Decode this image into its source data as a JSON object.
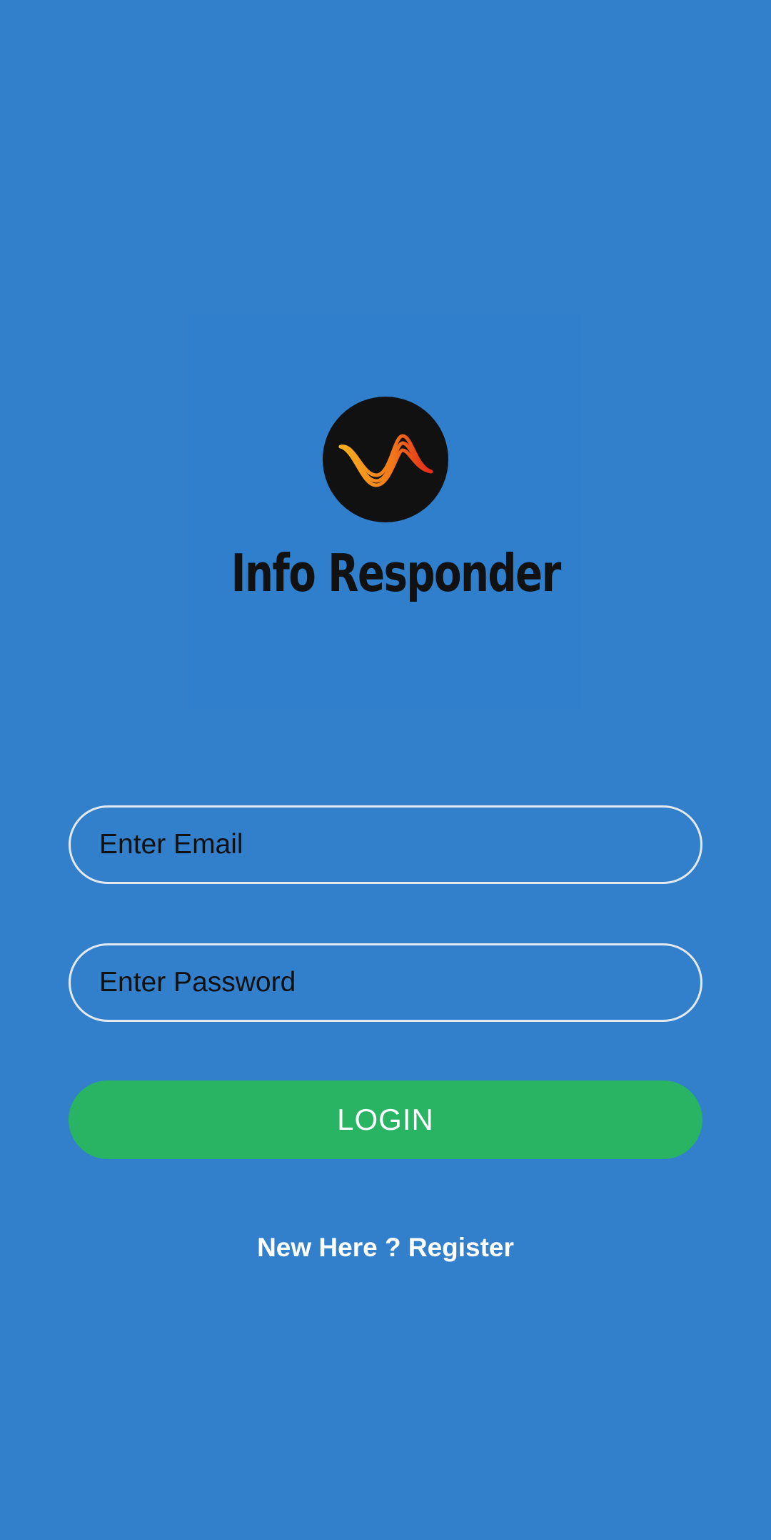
{
  "brand": {
    "name": "Info Responder",
    "logo_icon": "wave-logo-icon"
  },
  "form": {
    "email": {
      "placeholder": "Enter Email",
      "value": ""
    },
    "password": {
      "placeholder": "Enter Password",
      "value": ""
    },
    "login_label": "LOGIN",
    "register_label": "New Here ? Register"
  },
  "colors": {
    "background": "#327fcc",
    "login_button": "#28b463",
    "field_border": "#e4e9f0",
    "logo_circle": "#111111",
    "wave_orange": "#f5a623",
    "wave_red": "#e8341c"
  }
}
